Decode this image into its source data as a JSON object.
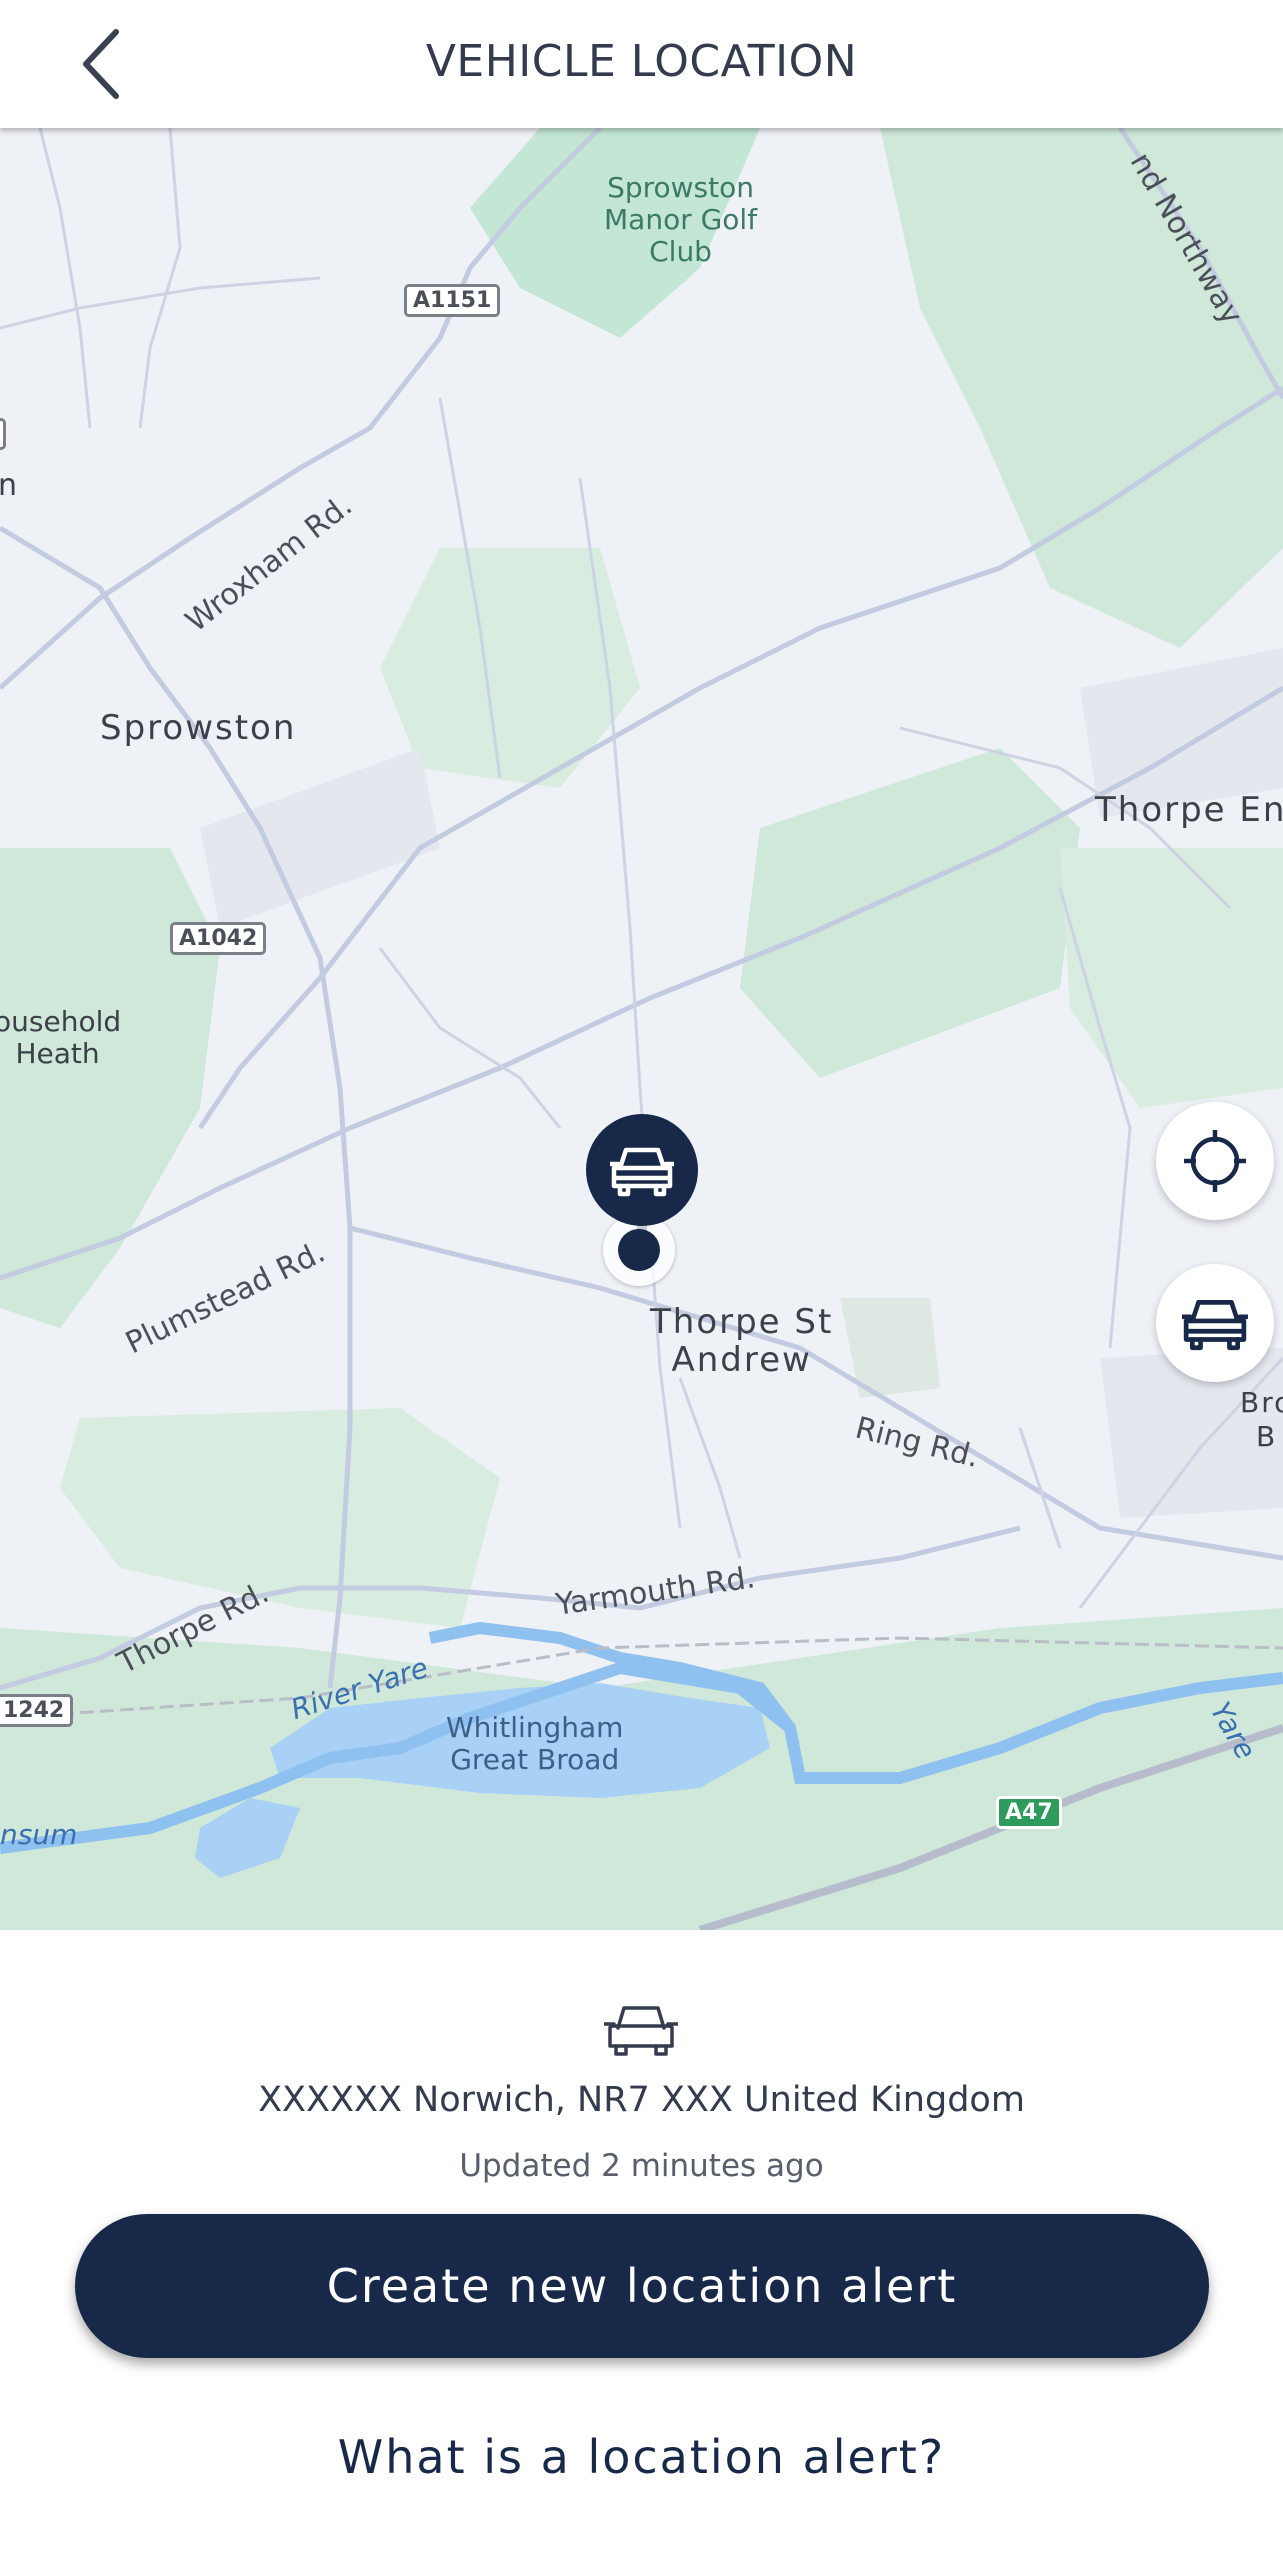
{
  "header": {
    "title": "VEHICLE LOCATION",
    "back_icon": "chevron-left-icon"
  },
  "map": {
    "places": {
      "sprowston": "Sprowston",
      "golf": "Sprowston\nManor Golf\nClub",
      "thorpe_end": "Thorpe End",
      "household": "Household\nHeath",
      "thorpe_st_andrew": "Thorpe St\nAndrew",
      "brundall_partial": "Bro\nB",
      "left_n": "n"
    },
    "roads": {
      "wroxham": "Wroxham Rd.",
      "plumstead": "Plumstead Rd.",
      "ring": "Ring Rd.",
      "thorpe": "Thorpe Rd.",
      "yarmouth": "Yarmouth Rd.",
      "northway": "nd Northway"
    },
    "water": {
      "river_yare": "River Yare",
      "whitlingham": "Whitlingham\nGreat Broad",
      "yare": "Yare",
      "sum": "nsum"
    },
    "shields": {
      "a1151": "A1151",
      "a1042": "A1042",
      "a1242": "1242",
      "a47": "A47"
    },
    "colors": {
      "land": "#eef1f6",
      "park": "#cfe8da",
      "water": "#a9d0f5",
      "road": "#c8d0e3"
    }
  },
  "controls": {
    "recenter_icon": "crosshair-icon",
    "vehicle_icon": "car-icon"
  },
  "info": {
    "vehicle_icon": "car-outline-icon",
    "address": "XXXXXX Norwich, NR7 XXX  United Kingdom",
    "updated": "Updated 2 minutes ago"
  },
  "actions": {
    "create_alert": "Create new location alert",
    "what_is_alert": "What is a location alert?"
  },
  "theme": {
    "primary": "#172848"
  }
}
